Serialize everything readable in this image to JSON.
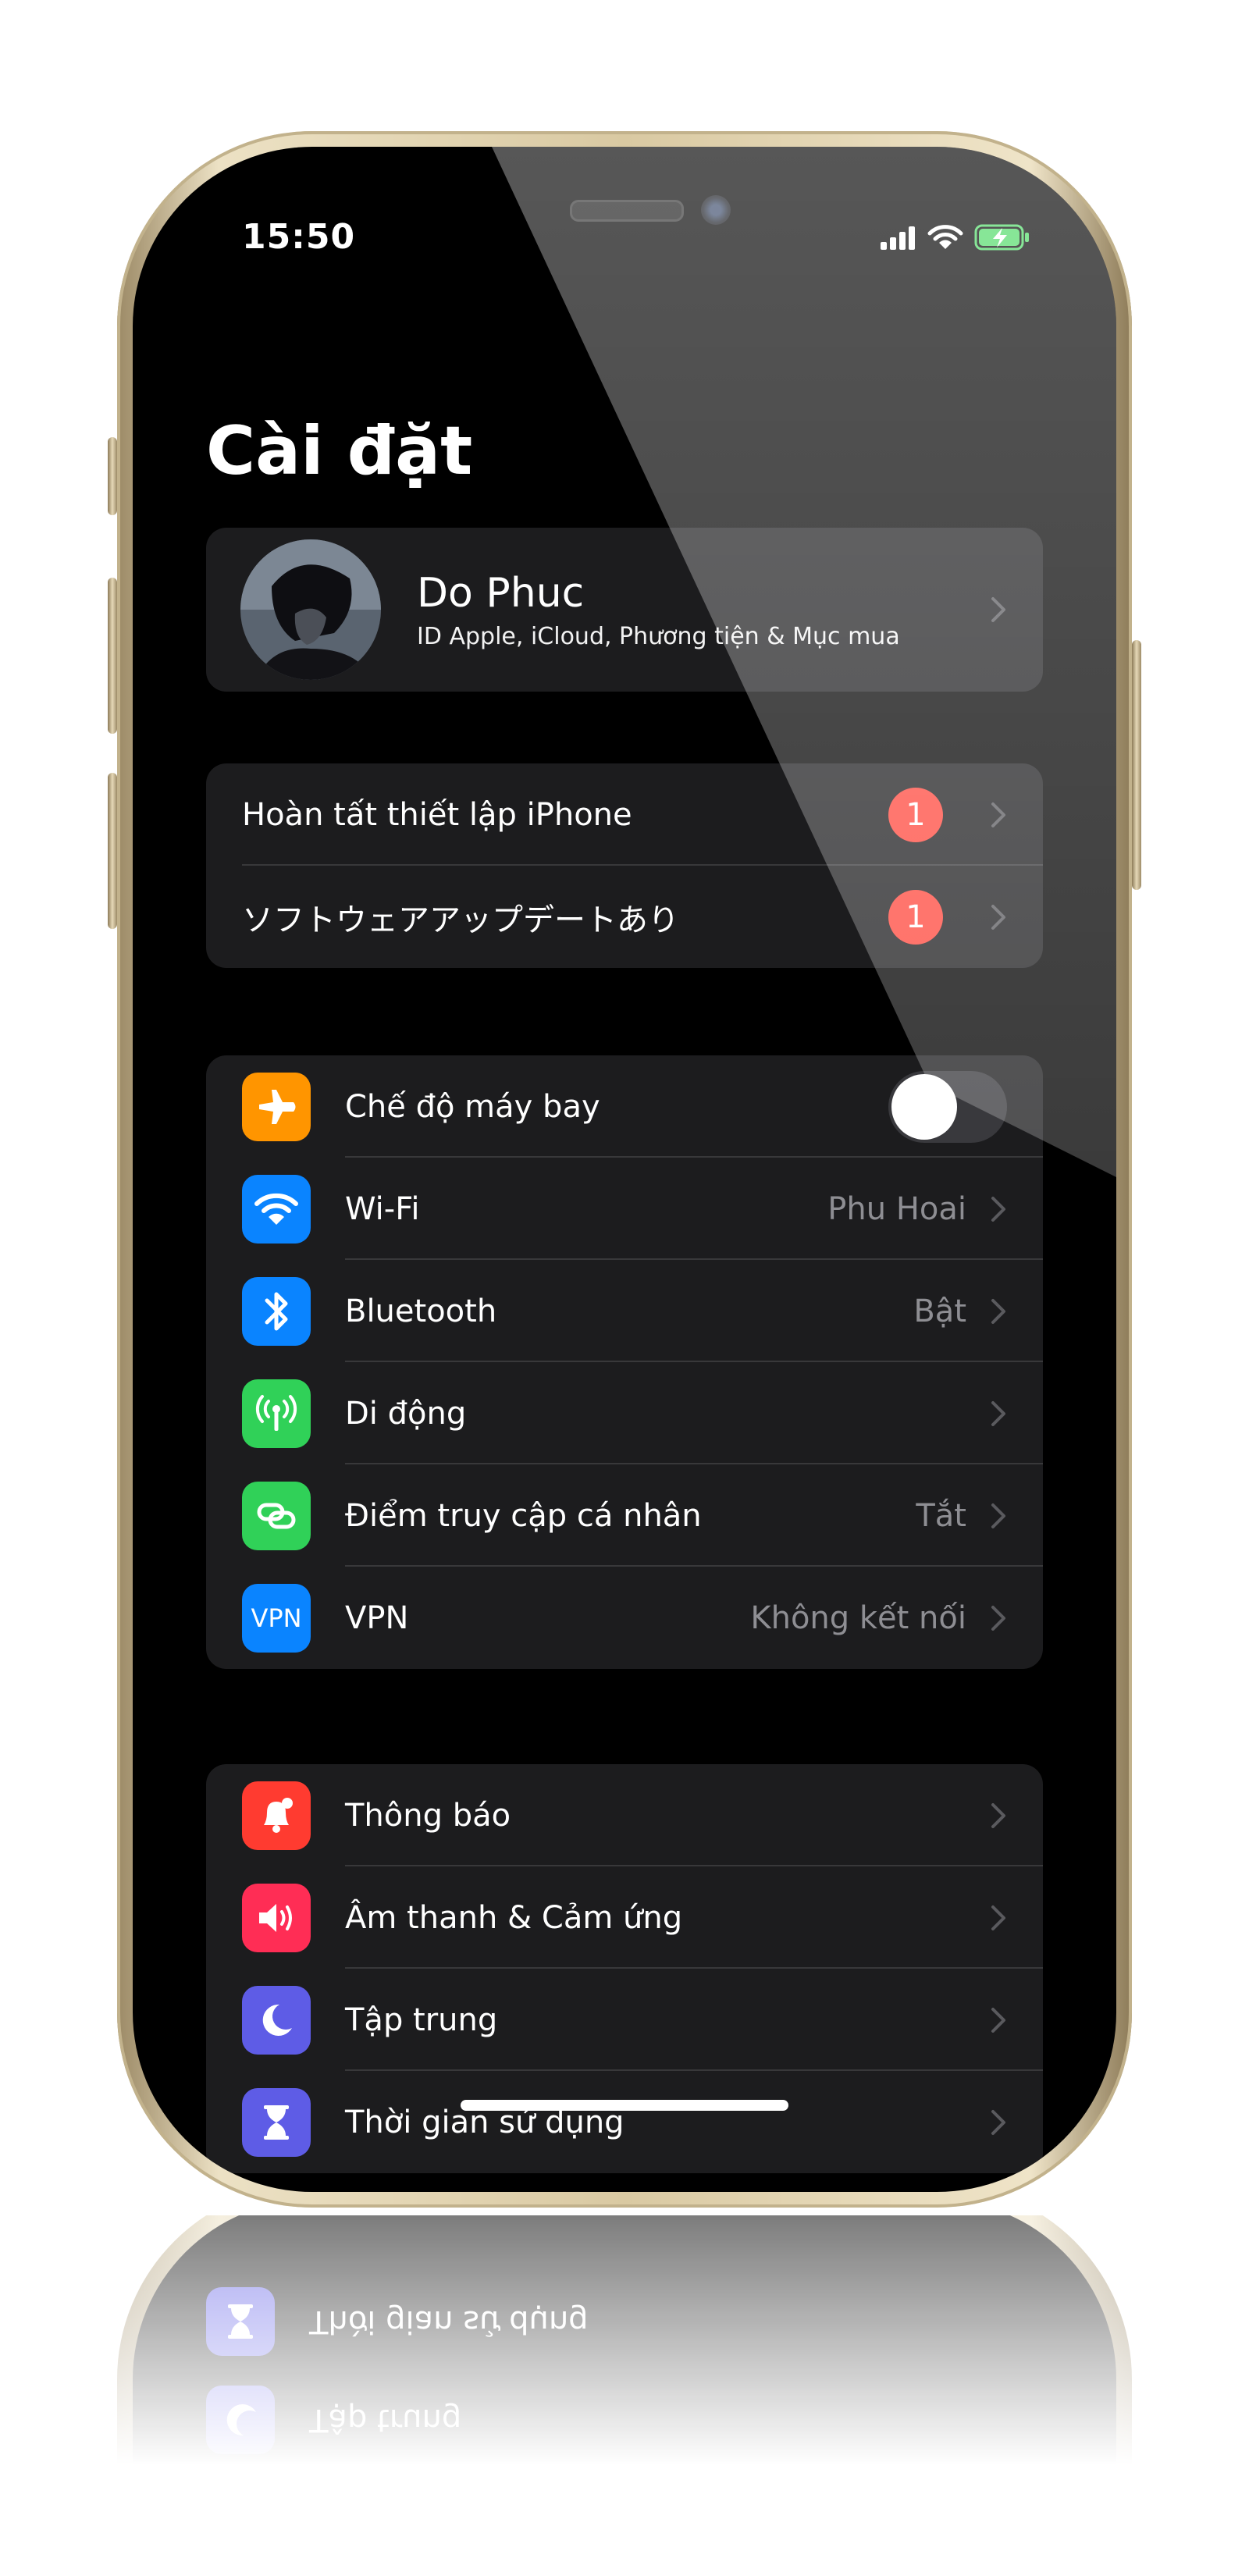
{
  "status_bar": {
    "time": "15:50",
    "signal_icon": "cellular-signal-icon",
    "wifi_icon": "wifi-icon",
    "battery_icon": "battery-charging-icon"
  },
  "page": {
    "title": "Cài đặt"
  },
  "profile": {
    "name": "Do Phuc",
    "subtitle": "ID Apple, iCloud, Phương tiện & Mục mua"
  },
  "suggestions": [
    {
      "label": "Hoàn tất thiết lập iPhone",
      "badge": "1"
    },
    {
      "label": "ソフトウェアアップデートあり",
      "badge": "1"
    }
  ],
  "connectivity": {
    "airplane": {
      "label": "Chế độ máy bay",
      "on": false,
      "icon": "airplane-icon",
      "color": "#ff9500"
    },
    "wifi": {
      "label": "Wi-Fi",
      "value": "Phu Hoai",
      "icon": "wifi-icon",
      "color": "#0a84ff"
    },
    "bluetooth": {
      "label": "Bluetooth",
      "value": "Bật",
      "icon": "bluetooth-icon",
      "color": "#0a84ff"
    },
    "cellular": {
      "label": "Di động",
      "icon": "antenna-icon",
      "color": "#30d158"
    },
    "hotspot": {
      "label": "Điểm truy cập cá nhân",
      "value": "Tắt",
      "icon": "hotspot-link-icon",
      "color": "#30d158"
    },
    "vpn": {
      "label": "VPN",
      "value": "Không kết nối",
      "icon_text": "VPN",
      "color": "#0a84ff"
    }
  },
  "general": {
    "notifications": {
      "label": "Thông báo",
      "icon": "bell-icon",
      "color": "#ff3b30"
    },
    "sounds": {
      "label": "Âm thanh & Cảm ứng",
      "icon": "speaker-icon",
      "color": "#ff2d55"
    },
    "focus": {
      "label": "Tập trung",
      "icon": "moon-icon",
      "color": "#5e5ce6"
    },
    "screen_time": {
      "label": "Thời gian sử dụng",
      "icon": "hourglass-icon",
      "color": "#5e5ce6"
    }
  },
  "frame_color": "#e6d9b8",
  "background": "#000000"
}
